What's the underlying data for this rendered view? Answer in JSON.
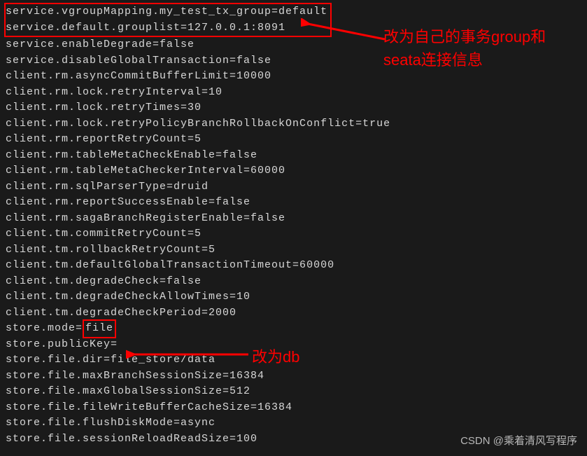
{
  "config": {
    "boxed_lines": [
      "service.vgroupMapping.my_test_tx_group=default",
      "service.default.grouplist=127.0.0.1:8091"
    ],
    "lines": [
      "service.enableDegrade=false",
      "service.disableGlobalTransaction=false",
      "client.rm.asyncCommitBufferLimit=10000",
      "client.rm.lock.retryInterval=10",
      "client.rm.lock.retryTimes=30",
      "client.rm.lock.retryPolicyBranchRollbackOnConflict=true",
      "client.rm.reportRetryCount=5",
      "client.rm.tableMetaCheckEnable=false",
      "client.rm.tableMetaCheckerInterval=60000",
      "client.rm.sqlParserType=druid",
      "client.rm.reportSuccessEnable=false",
      "client.rm.sagaBranchRegisterEnable=false",
      "client.tm.commitRetryCount=5",
      "client.tm.rollbackRetryCount=5",
      "client.tm.defaultGlobalTransactionTimeout=60000",
      "client.tm.degradeCheck=false",
      "client.tm.degradeCheckAllowTimes=10",
      "client.tm.degradeCheckPeriod=2000"
    ],
    "store_mode_prefix": "store.mode=",
    "store_mode_value": "file",
    "lines_after": [
      "store.publicKey=",
      "store.file.dir=file_store/data",
      "store.file.maxBranchSessionSize=16384",
      "store.file.maxGlobalSessionSize=512",
      "store.file.fileWriteBufferCacheSize=16384",
      "store.file.flushDiskMode=async",
      "store.file.sessionReloadReadSize=100"
    ]
  },
  "annotations": {
    "top": "改为自己的事务group和seata连接信息",
    "mid": "改为db"
  },
  "watermark": "CSDN @乘着清风写程序"
}
